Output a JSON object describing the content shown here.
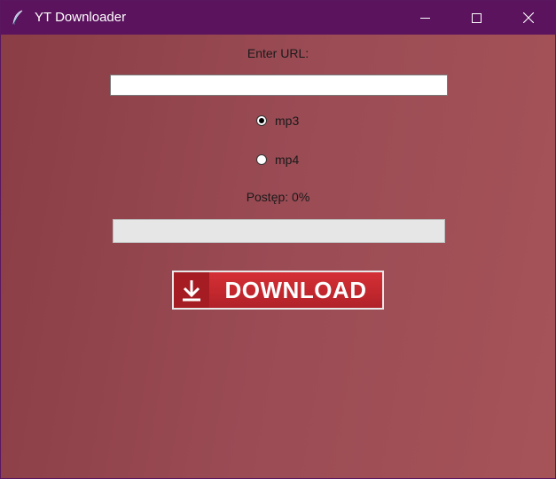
{
  "window": {
    "title": "YT Downloader",
    "icon": "feather-icon"
  },
  "form": {
    "url_label": "Enter URL:",
    "url_value": "",
    "url_placeholder": ""
  },
  "format_options": [
    {
      "label": "mp3",
      "checked": true
    },
    {
      "label": "mp4",
      "checked": false
    }
  ],
  "progress": {
    "label": "Postęp: 0%",
    "value_percent": 0
  },
  "download_button": {
    "label": "DOWNLOAD",
    "icon": "download-arrow-icon"
  },
  "colors": {
    "titlebar": "#5b135e",
    "background_start": "#8a3d45",
    "background_end": "#a65358",
    "button_red": "#c1272d"
  }
}
